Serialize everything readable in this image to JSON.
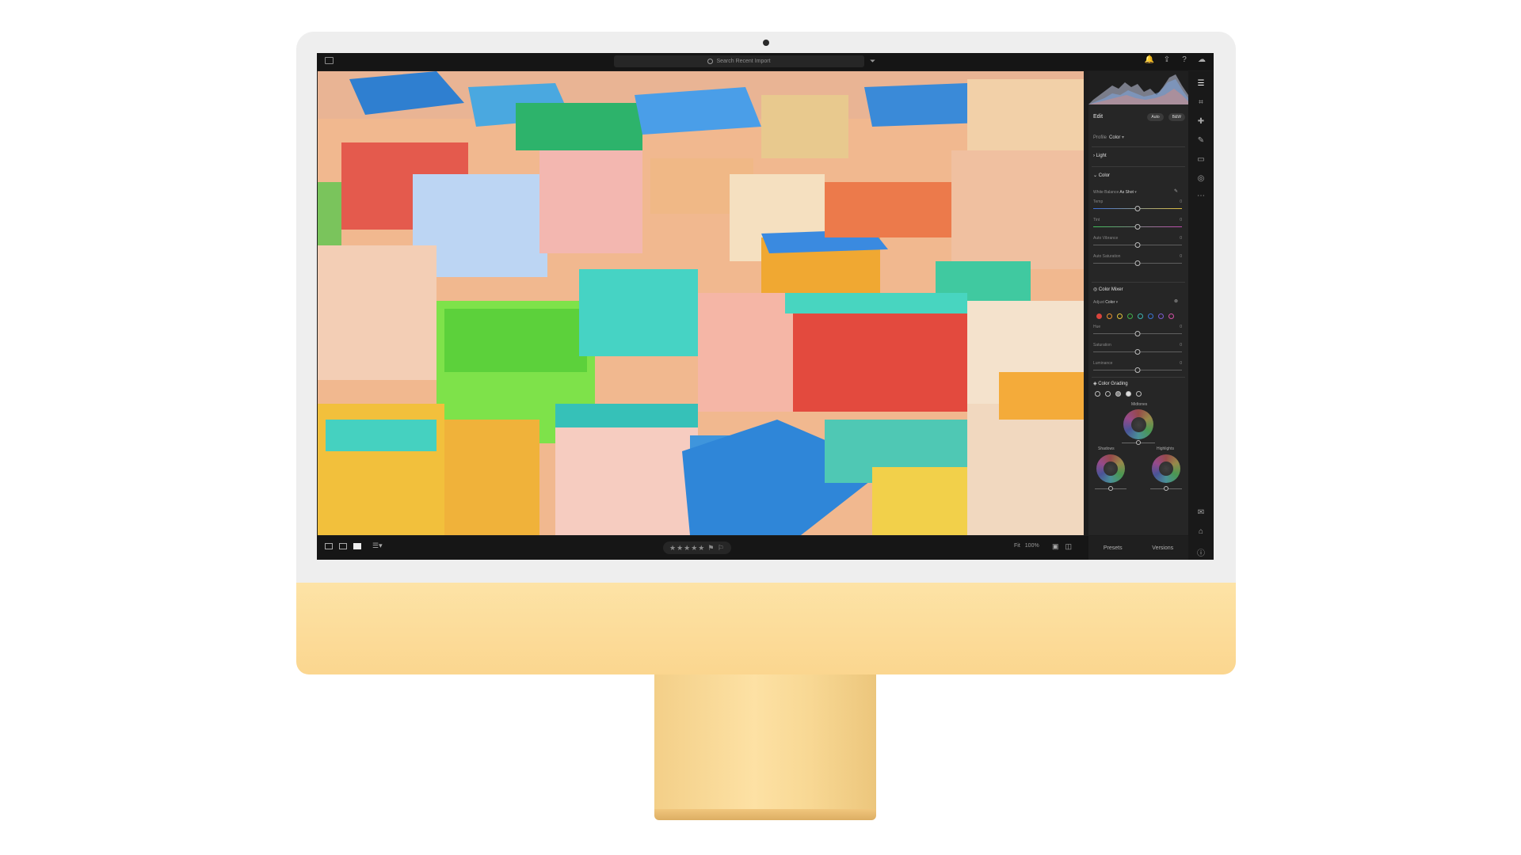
{
  "search": {
    "placeholder": "Search Recent Import"
  },
  "edit": {
    "title": "Edit",
    "auto_label": "Auto",
    "bw_label": "B&W",
    "profile_label": "Profile",
    "profile_value": "Color"
  },
  "light": {
    "label": "Light"
  },
  "color": {
    "label": "Color",
    "white_balance_label": "White Balance",
    "white_balance_value": "As Shot",
    "sliders": [
      {
        "label": "Temp",
        "value": "0"
      },
      {
        "label": "Tint",
        "value": "0"
      },
      {
        "label": "Auto Vibrance",
        "value": "0"
      },
      {
        "label": "Auto Saturation",
        "value": "0"
      }
    ]
  },
  "color_mixer": {
    "label": "Color Mixer",
    "adjust_label": "Adjust",
    "adjust_value": "Color",
    "swatches": [
      "#d9443c",
      "#e8922f",
      "#e2c33a",
      "#3fb04a",
      "#3cb3b0",
      "#3a74d4",
      "#7a5bd1",
      "#d24fa6"
    ],
    "sliders": [
      {
        "label": "Hue",
        "value": "0"
      },
      {
        "label": "Saturation",
        "value": "0"
      },
      {
        "label": "Luminance",
        "value": "0"
      }
    ]
  },
  "color_grading": {
    "label": "Color Grading",
    "midtones_label": "Midtones",
    "shadows_label": "Shadows",
    "highlights_label": "Highlights"
  },
  "bottom": {
    "rating": "★★★★★",
    "flags": "⚑ ⚐",
    "fit_label": "Fit",
    "zoom_value": "100%",
    "presets_label": "Presets",
    "versions_label": "Versions"
  }
}
